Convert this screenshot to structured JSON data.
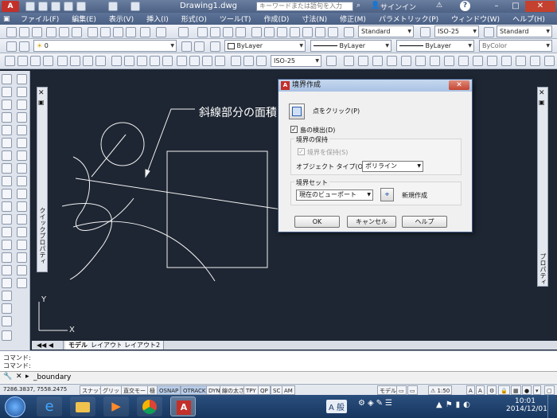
{
  "app": {
    "title": "Drawing1.dwg",
    "search_placeholder": "キーワードまたは語句を入力",
    "signin": "サインイン",
    "logo": "A",
    "help": "?"
  },
  "menu": [
    "ファイル(F)",
    "編集(E)",
    "表示(V)",
    "挿入(I)",
    "形式(O)",
    "ツール(T)",
    "作成(D)",
    "寸法(N)",
    "修正(M)",
    "パラメトリック(P)",
    "ウィンドウ(W)",
    "ヘルプ(H)"
  ],
  "toolbar1": {
    "text_style": "Standard",
    "dim_style": "ISO-25",
    "table_style": "Standard"
  },
  "toolbar2": {
    "layer": "0",
    "color": "ByLayer",
    "linetype": "ByLayer",
    "lineweight": "ByLayer",
    "plot_style": "ByColor"
  },
  "toolbar3": {
    "dim_style": "ISO-25"
  },
  "canvas": {
    "annotation": "斜線部分の面積"
  },
  "palettes": {
    "left_label": "クイックプロパティ",
    "right_label": "プロパティ"
  },
  "layout_tabs": [
    "モデル",
    "レイアウト1",
    "レイアウト2"
  ],
  "command": {
    "line1": "コマンド:",
    "line2": "コマンド:",
    "input": "_boundary"
  },
  "status": {
    "coords": "7286.3837, 7558.2475",
    "buttons": [
      "スナップ",
      "グリッド",
      "直交モード",
      "極",
      "OSNAP",
      "OTRACK",
      "DYN",
      "線の太さ",
      "TPY",
      "QP",
      "SC",
      "AM"
    ],
    "model": "モデル",
    "scale": "1:50"
  },
  "taskbar": {
    "time": "10:01",
    "date": "2014/12/01",
    "ime": "A 般"
  },
  "dialog": {
    "title": "境界作成",
    "pick_points": "点をクリック(P)",
    "island_detect": "島の検出(D)",
    "retention_group": "境界の保持",
    "retain_boundaries": "境界を保持(S)",
    "object_type_label": "オブジェクト タイプ(O):",
    "object_type": "ポリライン",
    "boundary_set_group": "境界セット",
    "boundary_set": "現在のビューポート",
    "new_label": "新規作成",
    "ok": "OK",
    "cancel": "キャンセル",
    "help": "ヘルプ"
  }
}
